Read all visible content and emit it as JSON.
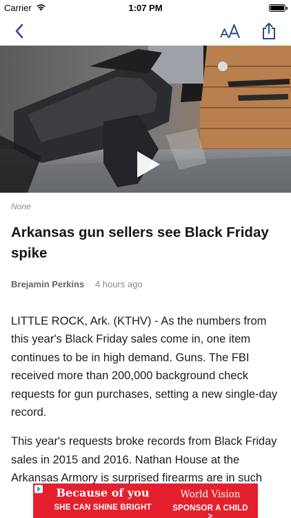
{
  "status_bar": {
    "carrier": "Carrier",
    "time": "1:07 PM",
    "battery_level": 1.0
  },
  "nav": {
    "back_icon": "chevron-left-icon",
    "font_size_icon": "text-size-icon",
    "share_icon": "share-icon",
    "tint_color": "#2c4a8c"
  },
  "media": {
    "play_icon": "play-icon"
  },
  "article": {
    "category": "None",
    "headline": "Arkansas gun sellers see Black Friday spike",
    "author": "Brejamin Perkins",
    "separator": "·",
    "timestamp": "4 hours ago",
    "paragraphs": [
      "LITTLE ROCK, Ark. (KTHV) - As the numbers from this year's Black Friday sales come in, one item continues to be in high demand. Guns. The FBI received more than 200,000 background check requests for gun purchases, setting a new single-day record.",
      "This year's requests broke records from Black Friday sales in 2015 and 2016. Nathan House at the Arkansas Armory is surprised firearms are in such"
    ]
  },
  "ad": {
    "line1": "Because of you",
    "line2": "SHE CAN SHINE BRIGHT",
    "brand": "World Vision",
    "cta": "SPONSOR A CHILD >",
    "color": "#e4202e"
  }
}
